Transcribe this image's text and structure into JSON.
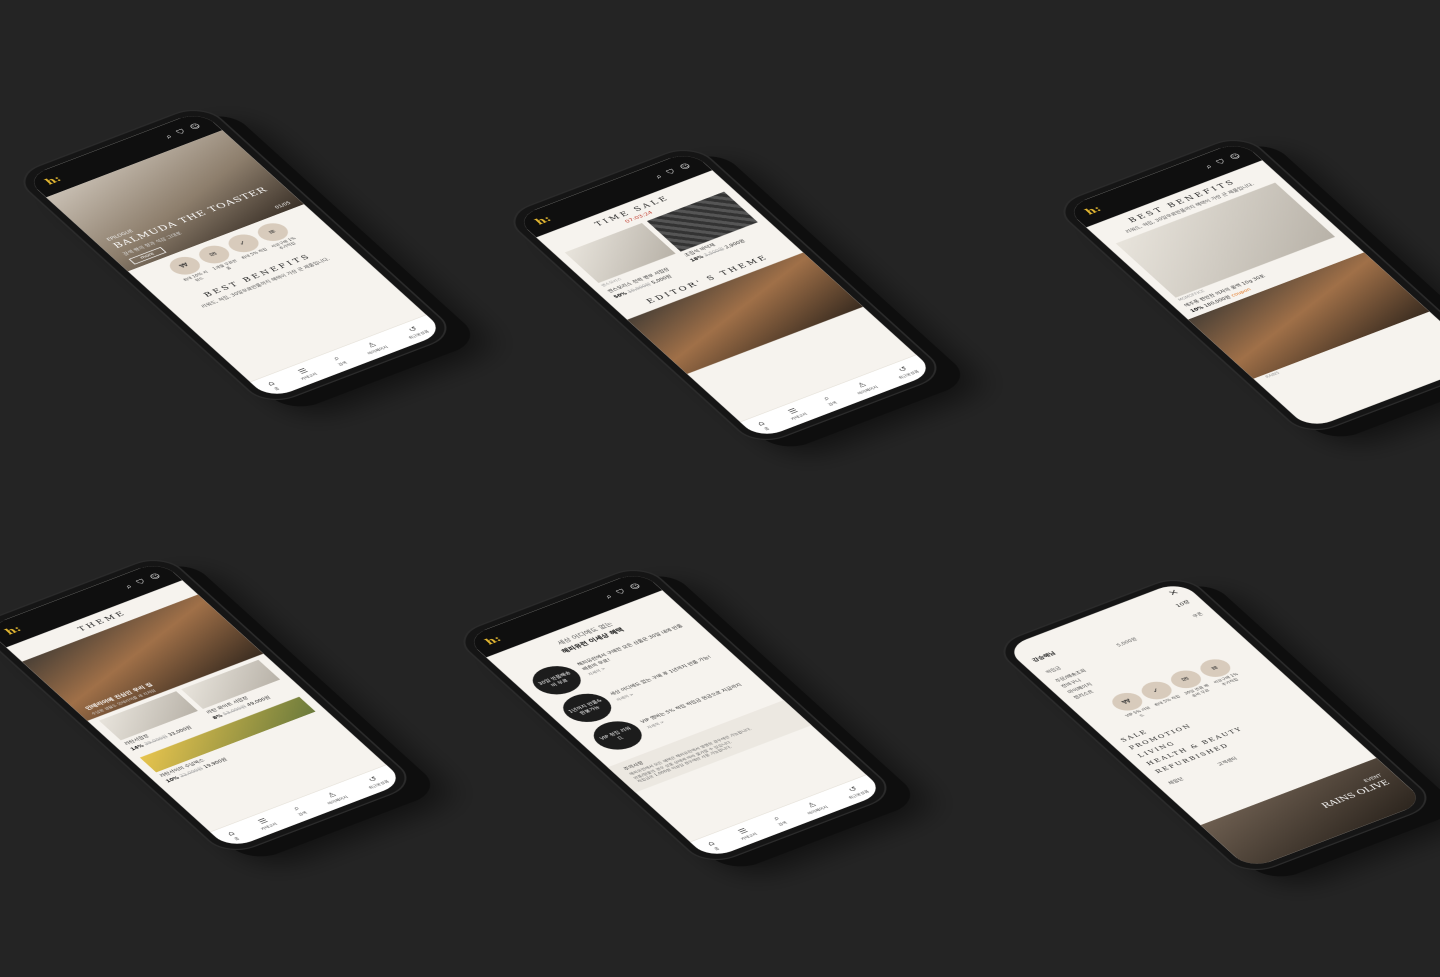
{
  "brand": {
    "logo": "h:",
    "accent": "#e3b731"
  },
  "topbar_icons": [
    "search-icon",
    "bag-icon",
    "smile-icon"
  ],
  "nav": [
    {
      "icon": "home-icon",
      "label": "홈",
      "glyph": "⌂"
    },
    {
      "icon": "menu-icon",
      "label": "카테고리",
      "glyph": "☰"
    },
    {
      "icon": "search-icon",
      "label": "검색",
      "glyph": "⌕"
    },
    {
      "icon": "user-icon",
      "label": "마이페이지",
      "glyph": "♙"
    },
    {
      "icon": "recent-icon",
      "label": "최근본상품",
      "glyph": "↺"
    }
  ],
  "phone1": {
    "hero_tag": "EPILOGUE",
    "hero_title": "BALMUDA THE TOASTER",
    "hero_desc": "갈색 빵의 향과 식감 그대로",
    "hero_btn": "more",
    "hero_page": "01/05",
    "benefits": [
      {
        "icon": "coupon-icon",
        "glyph": "₩",
        "label": "최대 10% 리워드"
      },
      {
        "icon": "free-shipping-icon",
        "glyph": "✉",
        "label": "1개월 무료반품"
      },
      {
        "icon": "bag-check-icon",
        "glyph": "✓",
        "label": "최대 5% 적립"
      },
      {
        "icon": "receipt-icon",
        "glyph": "≡",
        "label": "리뷰구매 1% 추가적립"
      }
    ],
    "section_title": "BEST BENEFITS",
    "section_sub": "리워드, 적립, 30일무료반품까지 혜택이 가장 큰 제품입니다."
  },
  "phone2": {
    "title": "TIME SALE",
    "timer": "07:03:24",
    "products": [
      {
        "brand": "벤스모리스",
        "name": "캔스모리스 전력 벤부 서랍장",
        "pct": "50%",
        "old": "10,000원",
        "price": "5,000원"
      },
      {
        "brand": "",
        "name": "조립식 바닥재",
        "pct": "18%",
        "old": "3,500원",
        "price": "2,900원"
      }
    ],
    "theme_title": "EDITOR' S THEME"
  },
  "phone3": {
    "title": "BEST BENEFITS",
    "sub": "리워드, 적립, 30일무료반품까지 혜택이 가장 큰 제품입니다.",
    "product": {
      "brand": "MGMOFFICE",
      "name": "에주풍 편안한 의자의 롤백 10g 30포",
      "pct": "10%",
      "price": "180,000원",
      "coupon": "coupon"
    },
    "tag": "RAINS"
  },
  "phone4": {
    "title": "THEME",
    "caption": "인테리어에 진심인 우리 집",
    "caption_sub": "수납한 생활도 인테리어를 새 차처럼",
    "products": [
      {
        "name": "라탄서랍장",
        "pct": "14%",
        "old": "39,000원",
        "price": "33,000원"
      },
      {
        "name": "라탄 화이트 서랍장",
        "pct": "8%",
        "old": "53,000원",
        "price": "49,000원"
      },
      {
        "name": "라탄서이미 수납박스",
        "pct": "10%",
        "old": "22,000원",
        "price": "19,900원"
      }
    ]
  },
  "phone5": {
    "title_line1": "세상 어디에도 없는",
    "title_line2": "해피유런 이세상 혜택",
    "features": [
      {
        "circle": "30일 반품배송비 무료",
        "text": "해피유런에서 구매한 모든 상품은 30일 내에 반품배송비 무료!",
        "more": "자세히 >"
      },
      {
        "circle": "1년까지 반품&환불가능",
        "text": "세상 어디에도 없는 구매 후 1년까지 반품 가능!",
        "more": "자세히 >"
      },
      {
        "circle": "VIP 정립 리워드",
        "text": "VIP 멤버는 5% 적립 적립금 현금으로 지급까지",
        "more": "자세히 >"
      }
    ],
    "notice_title": "주의사항",
    "notice_lines": [
      "해피유런에서 모든 혜택은 해피유런에서 발행된 경우에만 가능합니다.",
      "반품/환불의 경우 상품 상태에 따라 불가할 수 있습니다.",
      "적립금은 1,000원 이상일 경우에만 사용 가능합니다."
    ]
  },
  "phone6": {
    "close": "×",
    "user": "강승해님",
    "count": "10장",
    "points_label": "적립금",
    "points": "5,000원",
    "coupon_label": "쿠폰",
    "links": [
      "주문/배송조회",
      "장바구니",
      "마이페이지",
      "찜리스트"
    ],
    "benefits": [
      {
        "icon": "vip-icon",
        "glyph": "₩",
        "label": "VIP 5% 리워드"
      },
      {
        "icon": "bag-icon",
        "glyph": "✓",
        "label": "최대 5% 적립"
      },
      {
        "icon": "return-icon",
        "glyph": "✉",
        "label": "30일 반품 배송비 무료"
      },
      {
        "icon": "receipt-icon",
        "glyph": "≡",
        "label": "리뷰구매 1% 추가적립"
      }
    ],
    "categories": [
      "SALE",
      "PROMOTION",
      "LIVING",
      "HEALTH & BEAUTY",
      "REFURBISHED"
    ],
    "event_tag": "EVENT",
    "event_title": "RAINS OLIVE",
    "service": "체험단",
    "cs": "고객센터"
  }
}
